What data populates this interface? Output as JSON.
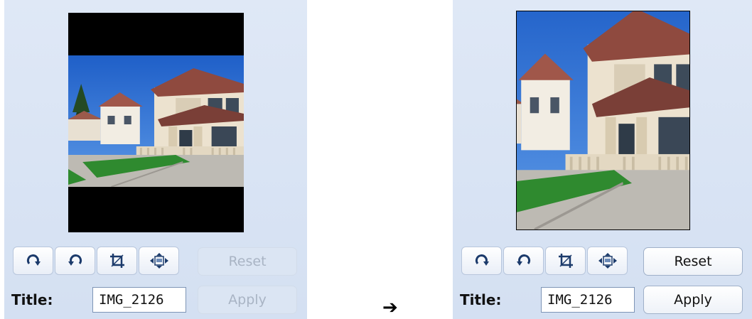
{
  "before": {
    "toolbar": {
      "rotate_cw_icon": "rotate-clockwise-icon",
      "rotate_ccw_icon": "rotate-counterclockwise-icon",
      "crop_icon": "crop-icon",
      "fit_icon": "fit-to-frame-icon"
    },
    "reset_label": "Reset",
    "apply_label": "Apply",
    "title_label": "Title:",
    "title_value": "IMG_2126",
    "reset_enabled": false,
    "apply_enabled": false
  },
  "after": {
    "toolbar": {
      "rotate_cw_icon": "rotate-clockwise-icon",
      "rotate_ccw_icon": "rotate-counterclockwise-icon",
      "crop_icon": "crop-icon",
      "fit_icon": "fit-to-frame-icon"
    },
    "reset_label": "Reset",
    "apply_label": "Apply",
    "title_label": "Title:",
    "title_value": "IMG_2126",
    "reset_enabled": true,
    "apply_enabled": true
  },
  "transition_arrow": "➔",
  "colors": {
    "panel_bg": "#d9e4f4",
    "sky": "#2b6fd6",
    "house_wall": "#efe6d6",
    "roof": "#a8574a",
    "grass": "#2f8a2f",
    "driveway": "#b9b7b2"
  }
}
